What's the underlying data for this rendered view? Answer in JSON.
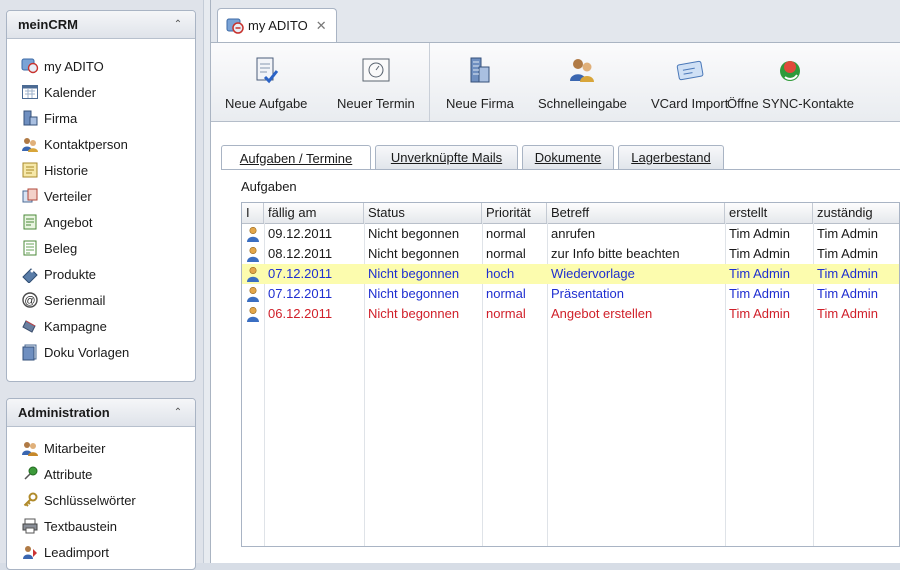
{
  "sidebar": {
    "panels": [
      {
        "title": "meinCRM",
        "items": [
          {
            "label": "my ADITO",
            "icon": "my-adito-icon"
          },
          {
            "label": "Kalender",
            "icon": "calendar-icon"
          },
          {
            "label": "Firma",
            "icon": "company-icon"
          },
          {
            "label": "Kontaktperson",
            "icon": "contact-person-icon"
          },
          {
            "label": "Historie",
            "icon": "history-icon"
          },
          {
            "label": "Verteiler",
            "icon": "distribution-icon"
          },
          {
            "label": "Angebot",
            "icon": "offer-icon"
          },
          {
            "label": "Beleg",
            "icon": "receipt-icon"
          },
          {
            "label": "Produkte",
            "icon": "products-icon"
          },
          {
            "label": "Serienmail",
            "icon": "mail-icon"
          },
          {
            "label": "Kampagne",
            "icon": "campaign-icon"
          },
          {
            "label": "Doku Vorlagen",
            "icon": "doc-templates-icon"
          }
        ]
      },
      {
        "title": "Administration",
        "items": [
          {
            "label": "Mitarbeiter",
            "icon": "employees-icon"
          },
          {
            "label": "Attribute",
            "icon": "pin-icon"
          },
          {
            "label": "Schlüsselwörter",
            "icon": "key-icon"
          },
          {
            "label": "Textbaustein",
            "icon": "printer-icon"
          },
          {
            "label": "Leadimport",
            "icon": "import-icon"
          }
        ]
      }
    ]
  },
  "doc_tab": {
    "label": "my ADITO",
    "close": "✕"
  },
  "toolbar": {
    "buttons": [
      {
        "label": "Neue Aufgabe",
        "icon": "new-task-icon"
      },
      {
        "label": "Neuer Termin",
        "icon": "new-appointment-icon"
      },
      {
        "label": "Neue Firma",
        "icon": "new-company-icon"
      },
      {
        "label": "Schnelleingabe",
        "icon": "quick-entry-icon"
      },
      {
        "label": "VCard Import",
        "icon": "vcard-icon"
      },
      {
        "label": "Öffne SYNC-Kontakte",
        "icon": "sync-contacts-icon"
      }
    ]
  },
  "subtabs": [
    {
      "label": "Aufgaben / Termine",
      "active": true
    },
    {
      "label": "Unverknüpfte Mails",
      "active": false
    },
    {
      "label": "Dokumente",
      "active": false
    },
    {
      "label": "Lagerbestand",
      "active": false
    }
  ],
  "section_label": "Aufgaben",
  "table": {
    "columns": [
      "I",
      "fällig am",
      "Status",
      "Priorität",
      "Betreff",
      "erstellt",
      "zuständig"
    ],
    "rows": [
      {
        "due": "09.12.2011",
        "status": "Nicht begonnen",
        "priority": "normal",
        "subject": "anrufen",
        "created": "Tim Admin",
        "assignee": "Tim Admin",
        "color": "#1a1a1a",
        "highlight": false
      },
      {
        "due": "08.12.2011",
        "status": "Nicht begonnen",
        "priority": "normal",
        "subject": "zur Info bitte beachten",
        "created": "Tim Admin",
        "assignee": "Tim Admin",
        "color": "#1a1a1a",
        "highlight": false
      },
      {
        "due": "07.12.2011",
        "status": "Nicht begonnen",
        "priority": "hoch",
        "subject": "Wiedervorlage",
        "created": "Tim Admin",
        "assignee": "Tim Admin",
        "color": "#1f2fd0",
        "highlight": true
      },
      {
        "due": "07.12.2011",
        "status": "Nicht begonnen",
        "priority": "normal",
        "subject": "Präsentation",
        "created": "Tim Admin",
        "assignee": "Tim Admin",
        "color": "#1f2fd0",
        "highlight": false
      },
      {
        "due": "06.12.2011",
        "status": "Nicht begonnen",
        "priority": "normal",
        "subject": "Angebot erstellen",
        "created": "Tim Admin",
        "assignee": "Tim Admin",
        "color": "#d0202a",
        "highlight": false
      }
    ]
  }
}
